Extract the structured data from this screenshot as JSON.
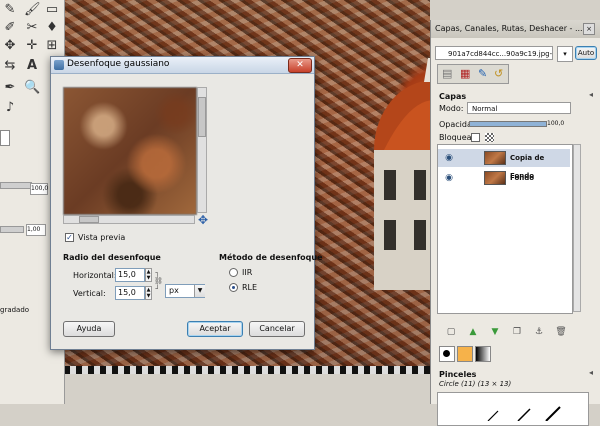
{
  "toolbox": {
    "tools": [
      "pencil-icon",
      "paintbrush-icon",
      "eraser-icon",
      "airbrush-icon",
      "move-icon",
      "crosshair-icon",
      "measure-icon",
      "zoom-icon",
      "text-icon",
      "fuzzy-select-icon",
      "picker-icon",
      "heal-icon",
      "guitar-icon",
      "knife-icon"
    ],
    "value_1": "100,0",
    "value_2": "1,00",
    "label_gradient": "gradado"
  },
  "dialog": {
    "title": "Desenfoque gaussiano",
    "close_label": "✕",
    "preview_checkbox_label": "Vista previa",
    "blur_radius_heading": "Radio del desenfoque",
    "horizontal_label": "Horizontal:",
    "horizontal_value": "15,0",
    "vertical_label": "Vertical:",
    "vertical_value": "15,0",
    "unit_select": "px",
    "method_heading": "Método de desenfoque",
    "method_iir": "IIR",
    "method_rle": "RLE",
    "selected_method": "RLE",
    "help_button": "Ayuda",
    "ok_button": "Aceptar",
    "cancel_button": "Cancelar"
  },
  "layers_panel": {
    "title": "Capas, Canales, Rutas, Deshacer - ...",
    "image_selector": "901a7cd844cc...90a9c19.jpg-2",
    "auto_button": "Auto",
    "section_title": "Capas",
    "mode_label": "Modo:",
    "mode_value": "Normal",
    "opacity_label": "Opacidad:",
    "opacity_value": "100,0",
    "lock_label": "Bloquear:",
    "layers": [
      {
        "name": "Copia de Fondo",
        "selected": true
      },
      {
        "name": "Fondo",
        "selected": false
      }
    ],
    "brushes_title": "Pinceles",
    "brush_name": "Circle (11) (13 × 13)"
  },
  "colors": {
    "accent": "#3c7fb1",
    "dialog_bg": "#e9e8e4",
    "title_gradient_top": "#eaf0f8"
  }
}
